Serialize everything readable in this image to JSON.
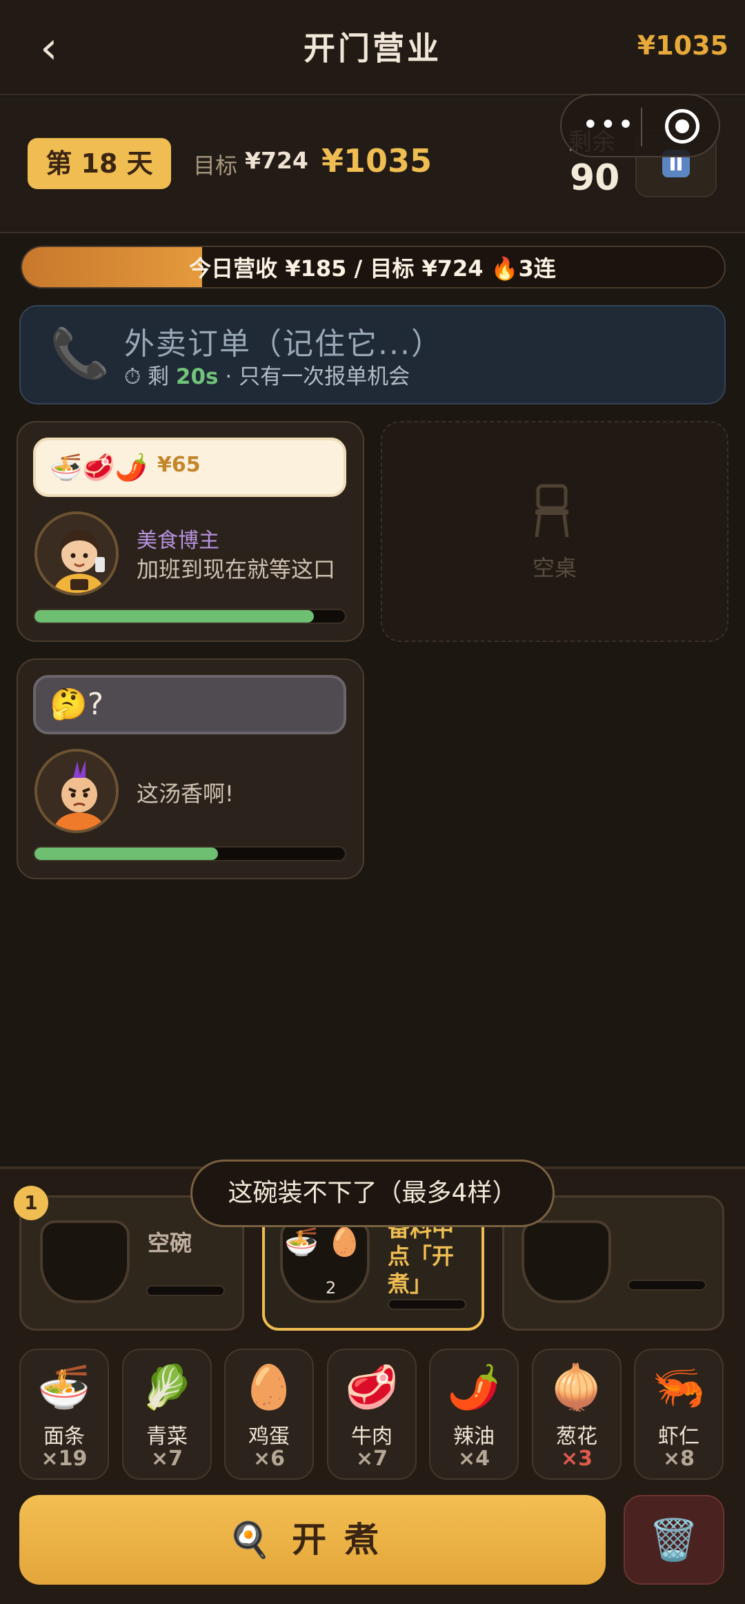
{
  "topbar": {
    "back_icon": "‹",
    "title": "开门营业",
    "money": "¥1035"
  },
  "header": {
    "day": "第 18 天",
    "target_label": "目标",
    "target_value": "¥724",
    "current_money": "¥1035",
    "remaining_label": "剩余",
    "remaining_value": "90"
  },
  "capsule": {
    "more_icon": "•••"
  },
  "progress": {
    "text": "今日营收 ¥185 / 目标 ¥724 🔥3连",
    "fraction": 0.256
  },
  "delivery": {
    "icon": "📞",
    "title": "外卖订单（记住它...）",
    "timer_icon": "⏱",
    "prefix": "剩",
    "seconds": "20s",
    "suffix": "· 只有一次报单机会"
  },
  "tables": [
    {
      "order_icons": "🍜🥩🌶️",
      "price": "¥65",
      "avatar": "🧑‍💻",
      "name": "美食博主",
      "say": "加班到现在就等这口",
      "patience": 0.9
    },
    {
      "order_icons": "🤔?",
      "price": "",
      "avatar": "😠",
      "name": "",
      "say": "这汤香啊!",
      "patience": 0.59
    }
  ],
  "empty_table": {
    "label": "空桌"
  },
  "pots": {
    "pot1": {
      "number": "1",
      "label": "空碗"
    },
    "pot2": {
      "items": "🍜 🥚",
      "count": "2",
      "text": "备料中 点「开煮」"
    }
  },
  "toast": "这碗装不下了（最多4样）",
  "ingredients": [
    {
      "emoji": "🍜",
      "name": "面条",
      "count": "×19",
      "low": false
    },
    {
      "emoji": "🥬",
      "name": "青菜",
      "count": "×7",
      "low": false
    },
    {
      "emoji": "🥚",
      "name": "鸡蛋",
      "count": "×6",
      "low": false
    },
    {
      "emoji": "🥩",
      "name": "牛肉",
      "count": "×7",
      "low": false
    },
    {
      "emoji": "🌶️",
      "name": "辣油",
      "count": "×4",
      "low": false
    },
    {
      "emoji": "🧅",
      "name": "葱花",
      "count": "×3",
      "low": true
    },
    {
      "emoji": "🦐",
      "name": "虾仁",
      "count": "×8",
      "low": false
    }
  ],
  "actions": {
    "cook_icon": "🍳",
    "cook_label": "开煮",
    "trash_icon": "🗑️"
  },
  "colors": {
    "accent": "#efbd52",
    "patience": "#6fbf73",
    "delivery_secs": "#72c37a",
    "low_stock": "#e05a4e"
  }
}
